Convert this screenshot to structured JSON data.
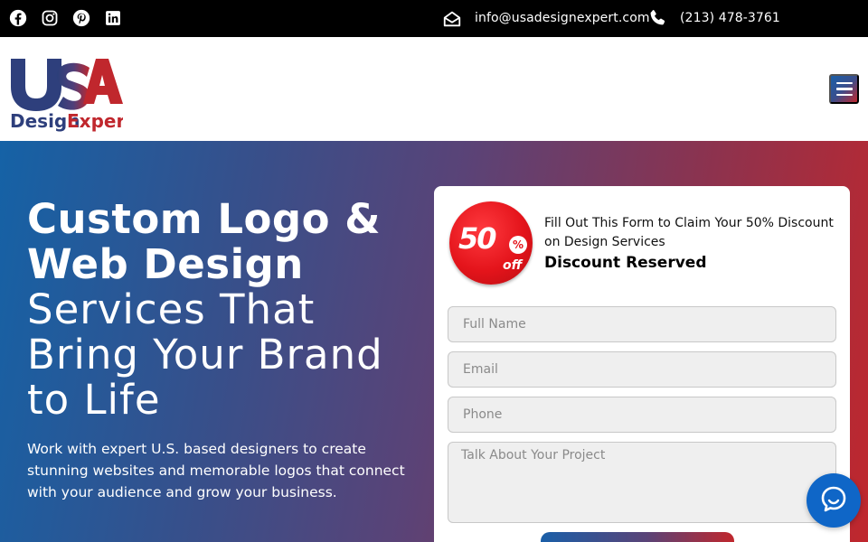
{
  "topbar": {
    "social_icons": [
      "facebook-icon",
      "instagram-icon",
      "pinterest-icon",
      "linkedin-icon"
    ],
    "email": "info@usadesignexpert.com",
    "phone": "(213) 478-3761"
  },
  "header": {
    "logo_text_top": "USA",
    "logo_text_design": "Design",
    "logo_text_expert": "Expert",
    "menu_icon": "hamburger-menu-icon"
  },
  "hero": {
    "title_bold_line1": "Custom Logo &",
    "title_bold_line2": "Web Design",
    "title_light_line1": "Services That",
    "title_light_line2": "Bring Your Brand",
    "title_light_line3": "to Life",
    "description": "Work with expert U.S. based designers to create stunning websites and memorable logos that connect with your audience and grow your business."
  },
  "form": {
    "badge_number": "50",
    "badge_percent": "%",
    "badge_off": "off",
    "subtitle": "Fill Out This Form to Claim Your 50% Discount on Design Services",
    "heading": "Discount Reserved",
    "full_name_placeholder": "Full Name",
    "email_placeholder": "Email",
    "phone_placeholder": "Phone",
    "project_placeholder": "Talk About Your Project"
  },
  "colors": {
    "brand_blue": "#1a5fa8",
    "brand_red": "#c0272d",
    "topbar": "#000000",
    "chat": "#0f66c7"
  }
}
